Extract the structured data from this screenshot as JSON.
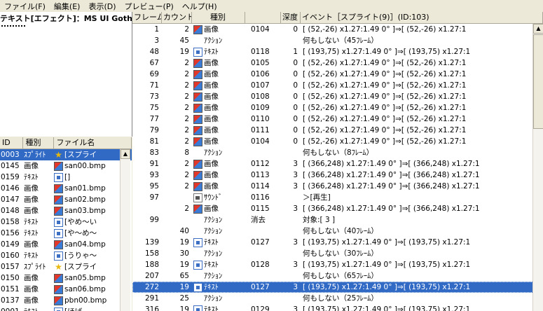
{
  "menu": [
    "ファイル(F)",
    "編集(E)",
    "表示(D)",
    "プレビュー(P)",
    "ヘルプ(H)"
  ],
  "left_top": {
    "title": "テキスト[エフェクト]：MS UI Gothic"
  },
  "left_list": {
    "headers": [
      "ID",
      "種別",
      "ファイル名"
    ],
    "rows": [
      {
        "id": "0003",
        "type": "ｽﾌﾟﾗｲﾄ",
        "icon": "star-icon",
        "file": "[スプライ",
        "selected": true
      },
      {
        "id": "0145",
        "type": "画像",
        "icon": "image-icon",
        "file": "san00.bmp"
      },
      {
        "id": "0159",
        "type": "ﾃｷｽﾄ",
        "icon": "text-icon",
        "file": "[]"
      },
      {
        "id": "0146",
        "type": "画像",
        "icon": "image-icon",
        "file": "san01.bmp"
      },
      {
        "id": "0147",
        "type": "画像",
        "icon": "image-icon",
        "file": "san02.bmp"
      },
      {
        "id": "0148",
        "type": "画像",
        "icon": "image-icon",
        "file": "san03.bmp"
      },
      {
        "id": "0158",
        "type": "ﾃｷｽﾄ",
        "icon": "text-icon",
        "file": "[やめ〜い"
      },
      {
        "id": "0156",
        "type": "ﾃｷｽﾄ",
        "icon": "text-icon",
        "file": "[や〜め〜"
      },
      {
        "id": "0149",
        "type": "画像",
        "icon": "image-icon",
        "file": "san04.bmp"
      },
      {
        "id": "0160",
        "type": "ﾃｷｽﾄ",
        "icon": "text-icon",
        "file": "[うりゃ〜"
      },
      {
        "id": "0157",
        "type": "ｽﾌﾟﾗｲﾄ",
        "icon": "star-icon",
        "file": "[スプライ"
      },
      {
        "id": "0150",
        "type": "画像",
        "icon": "image-icon",
        "file": "san05.bmp"
      },
      {
        "id": "0151",
        "type": "画像",
        "icon": "image-icon",
        "file": "san06.bmp"
      },
      {
        "id": "0137",
        "type": "画像",
        "icon": "image-icon",
        "file": "pbn00.bmp"
      },
      {
        "id": "0001",
        "type": "ﾃｷｽﾄ",
        "icon": "text-icon",
        "file": "[ほげ"
      }
    ],
    "scroll_up": "▲"
  },
  "main_table": {
    "headers": [
      "フレーム",
      "カウント",
      "種別",
      "",
      "深度",
      "イベント［スプライト(9)］(ID:103)"
    ],
    "rows": [
      {
        "frame": "1",
        "count": "2",
        "icon": "image-icon",
        "type": "画像",
        "ex": "0104",
        "depth": "0",
        "event": "[    (52,-26) x1.27:1.49    0° ]⇒[    (52,-26) x1.27:1"
      },
      {
        "frame": "3",
        "count": "45",
        "icon": "none",
        "type": "ｱｸｼｮﾝ",
        "ex": "",
        "depth": "",
        "event": "何もしない（45ﾌﾚｰﾑ）"
      },
      {
        "frame": "48",
        "count": "19",
        "icon": "text-icon",
        "type": "ﾃｷｽﾄ",
        "ex": "0118",
        "depth": "1",
        "event": "[    (193,75) x1.27:1.49    0° ]⇒[    (193,75) x1.27:1"
      },
      {
        "frame": "67",
        "count": "2",
        "icon": "image-icon",
        "type": "画像",
        "ex": "0105",
        "depth": "0",
        "event": "[    (52,-26) x1.27:1.49    0° ]⇒[    (52,-26) x1.27:1"
      },
      {
        "frame": "69",
        "count": "2",
        "icon": "image-icon",
        "type": "画像",
        "ex": "0106",
        "depth": "0",
        "event": "[    (52,-26) x1.27:1.49    0° ]⇒[    (52,-26) x1.27:1"
      },
      {
        "frame": "71",
        "count": "2",
        "icon": "image-icon",
        "type": "画像",
        "ex": "0107",
        "depth": "0",
        "event": "[    (52,-26) x1.27:1.49    0° ]⇒[    (52,-26) x1.27:1"
      },
      {
        "frame": "73",
        "count": "2",
        "icon": "image-icon",
        "type": "画像",
        "ex": "0108",
        "depth": "0",
        "event": "[    (52,-26) x1.27:1.49    0° ]⇒[    (52,-26) x1.27:1"
      },
      {
        "frame": "75",
        "count": "2",
        "icon": "image-icon",
        "type": "画像",
        "ex": "0109",
        "depth": "0",
        "event": "[    (52,-26) x1.27:1.49    0° ]⇒[    (52,-26) x1.27:1"
      },
      {
        "frame": "77",
        "count": "2",
        "icon": "image-icon",
        "type": "画像",
        "ex": "0110",
        "depth": "0",
        "event": "[    (52,-26) x1.27:1.49    0° ]⇒[    (52,-26) x1.27:1"
      },
      {
        "frame": "79",
        "count": "2",
        "icon": "image-icon",
        "type": "画像",
        "ex": "0111",
        "depth": "0",
        "event": "[    (52,-26) x1.27:1.49    0° ]⇒[    (52,-26) x1.27:1"
      },
      {
        "frame": "81",
        "count": "2",
        "icon": "image-icon",
        "type": "画像",
        "ex": "0104",
        "depth": "0",
        "event": "[    (52,-26) x1.27:1.49    0° ]⇒[    (52,-26) x1.27:1"
      },
      {
        "frame": "83",
        "count": "8",
        "icon": "none",
        "type": "ｱｸｼｮﾝ",
        "ex": "",
        "depth": "",
        "event": "何もしない（8ﾌﾚｰﾑ）"
      },
      {
        "frame": "91",
        "count": "2",
        "icon": "image-icon",
        "type": "画像",
        "ex": "0112",
        "depth": "3",
        "event": "[   (366,248) x1.27:1.49    0° ]⇒[   (366,248) x1.27:1"
      },
      {
        "frame": "93",
        "count": "2",
        "icon": "image-icon",
        "type": "画像",
        "ex": "0113",
        "depth": "3",
        "event": "[   (366,248) x1.27:1.49    0° ]⇒[   (366,248) x1.27:1"
      },
      {
        "frame": "95",
        "count": "2",
        "icon": "image-icon",
        "type": "画像",
        "ex": "0114",
        "depth": "3",
        "event": "[   (366,248) x1.27:1.49    0° ]⇒[   (366,248) x1.27:1"
      },
      {
        "frame": "97",
        "count": "",
        "icon": "sound-icon",
        "type": "ｻｳﾝﾄﾞ",
        "ex": "0116",
        "depth": "",
        "event": "＞[再生]"
      },
      {
        "frame": "",
        "count": "2",
        "icon": "image-icon",
        "type": "画像",
        "ex": "0115",
        "depth": "3",
        "event": "[   (366,248) x1.27:1.49    0° ]⇒[   (366,248) x1.27:1"
      },
      {
        "frame": "99",
        "count": "",
        "icon": "none",
        "type": "ｱｸｼｮﾝ",
        "ex": "消去",
        "depth": "",
        "event": "対象:[ 3 ]"
      },
      {
        "frame": "",
        "count": "40",
        "icon": "none",
        "type": "ｱｸｼｮﾝ",
        "ex": "",
        "depth": "",
        "event": "何もしない（40ﾌﾚｰﾑ）"
      },
      {
        "frame": "139",
        "count": "19",
        "icon": "text-icon",
        "type": "ﾃｷｽﾄ",
        "ex": "0127",
        "depth": "3",
        "event": "[    (193,75) x1.27:1.49    0° ]⇒[    (193,75) x1.27:1"
      },
      {
        "frame": "158",
        "count": "30",
        "icon": "none",
        "type": "ｱｸｼｮﾝ",
        "ex": "",
        "depth": "",
        "event": "何もしない（30ﾌﾚｰﾑ）"
      },
      {
        "frame": "188",
        "count": "19",
        "icon": "text-icon",
        "type": "ﾃｷｽﾄ",
        "ex": "0128",
        "depth": "3",
        "event": "[    (193,75) x1.27:1.49    0° ]⇒[    (193,75) x1.27:1"
      },
      {
        "frame": "207",
        "count": "65",
        "icon": "none",
        "type": "ｱｸｼｮﾝ",
        "ex": "",
        "depth": "",
        "event": "何もしない（65ﾌﾚｰﾑ）"
      },
      {
        "frame": "272",
        "count": "19",
        "icon": "text-icon",
        "type": "ﾃｷｽﾄ",
        "ex": "0127",
        "depth": "3",
        "event": "[    (193,75) x1.27:1.49    0° ]⇒[    (193,75) x1.27:1",
        "selected": true
      },
      {
        "frame": "291",
        "count": "25",
        "icon": "none",
        "type": "ｱｸｼｮﾝ",
        "ex": "",
        "depth": "",
        "event": "何もしない（25ﾌﾚｰﾑ）"
      },
      {
        "frame": "316",
        "count": "19",
        "icon": "text-icon",
        "type": "ﾃｷｽﾄ",
        "ex": "0129",
        "depth": "3",
        "event": "[    (193,75) x1.27:1.49    0° ]⇒[    (193,75) x1.27:1"
      }
    ],
    "scroll_up": "▲"
  }
}
